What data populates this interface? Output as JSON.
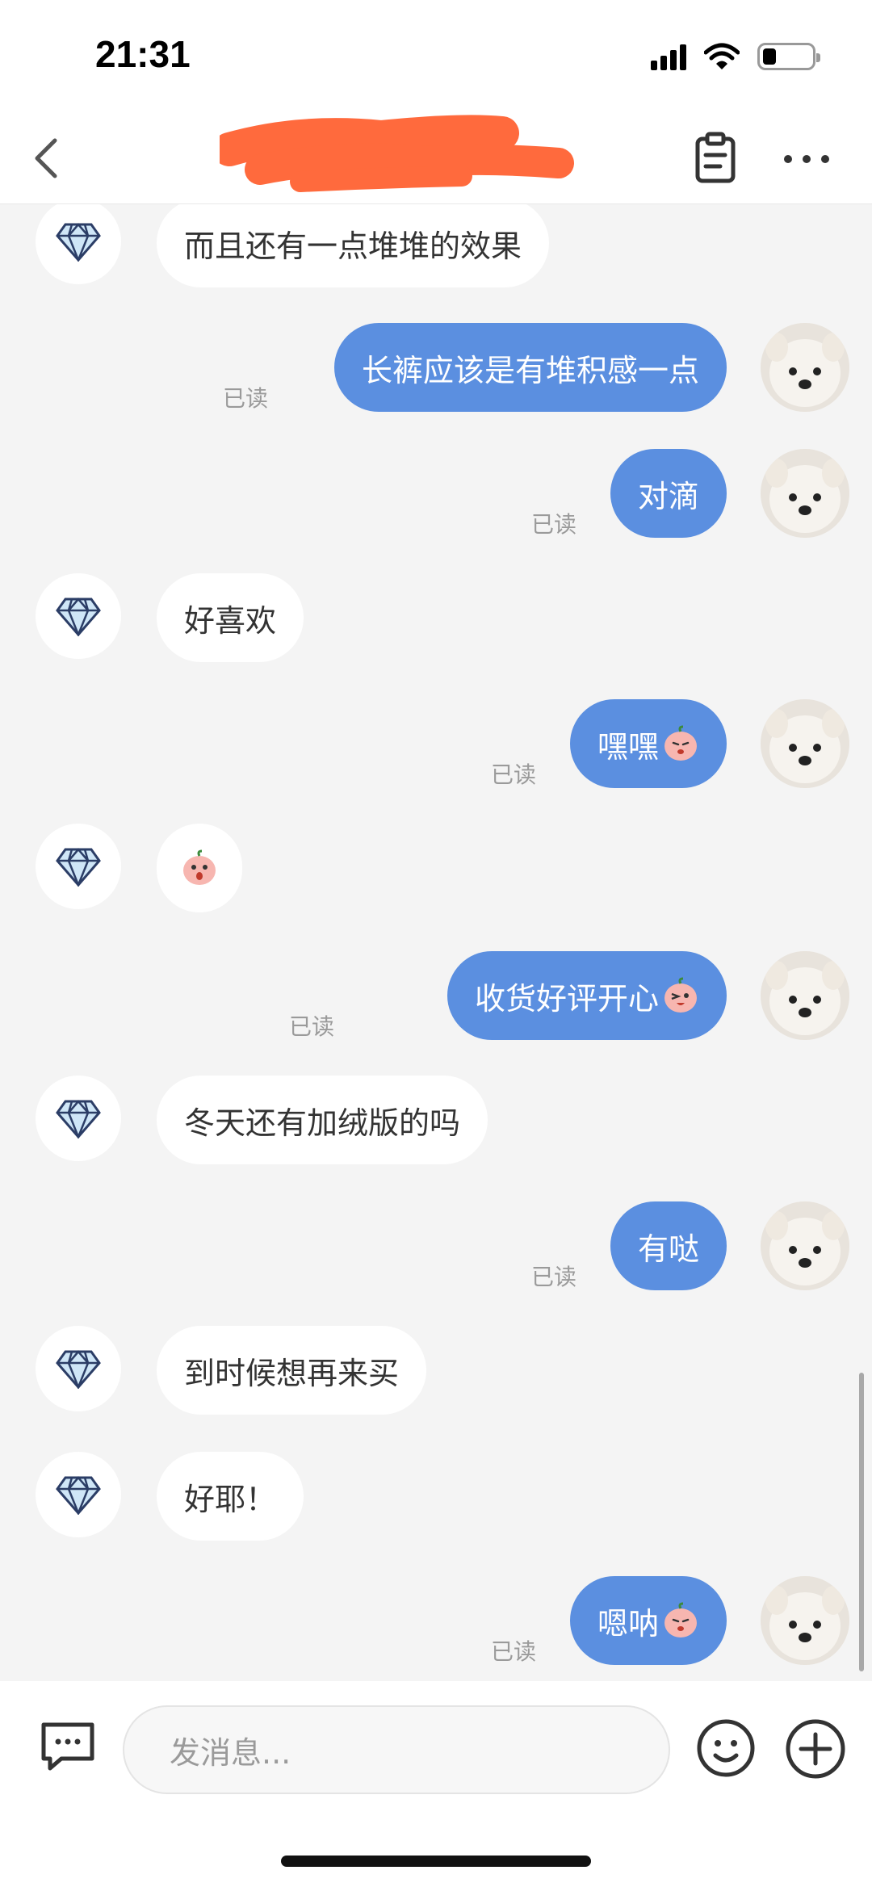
{
  "status": {
    "time": "21:31"
  },
  "nav": {
    "title": ""
  },
  "messages": [
    {
      "side": "in",
      "text": "而且还有一点堆堆的效果",
      "emoji": ""
    },
    {
      "side": "out",
      "text": "长裤应该是有堆积感一点",
      "emoji": "",
      "read": "已读"
    },
    {
      "side": "out",
      "text": "对滴",
      "emoji": "",
      "read": "已读"
    },
    {
      "side": "in",
      "text": "好喜欢",
      "emoji": ""
    },
    {
      "side": "out",
      "text": "嘿嘿",
      "emoji": "peach-shy-emoji",
      "read": "已读"
    },
    {
      "side": "in",
      "text": "",
      "emoji": "peach-surprised-emoji"
    },
    {
      "side": "out",
      "text": "收货好评开心",
      "emoji": "peach-wink-emoji",
      "read": "已读"
    },
    {
      "side": "in",
      "text": "冬天还有加绒版的吗",
      "emoji": ""
    },
    {
      "side": "out",
      "text": "有哒",
      "emoji": "",
      "read": "已读"
    },
    {
      "side": "in",
      "text": "到时候想再来买",
      "emoji": ""
    },
    {
      "side": "in",
      "text": "好耶！",
      "emoji": ""
    },
    {
      "side": "out",
      "text": "嗯呐",
      "emoji": "peach-shy-emoji",
      "read": "已读"
    }
  ],
  "input": {
    "placeholder": "发消息..."
  },
  "colors": {
    "outgoing_bubble": "#5b8fe0",
    "incoming_bubble": "#ffffff",
    "background": "#f4f4f4",
    "redaction": "#ff6a3d"
  },
  "icons": {
    "back": "chevron-left-icon",
    "order": "clipboard-icon",
    "more": "more-dots-icon",
    "seller_avatar": "diamond-icon",
    "user_avatar": "dog-photo",
    "chat": "chat-bubble-icon",
    "emoji": "smiley-icon",
    "plus": "plus-circle-icon"
  }
}
